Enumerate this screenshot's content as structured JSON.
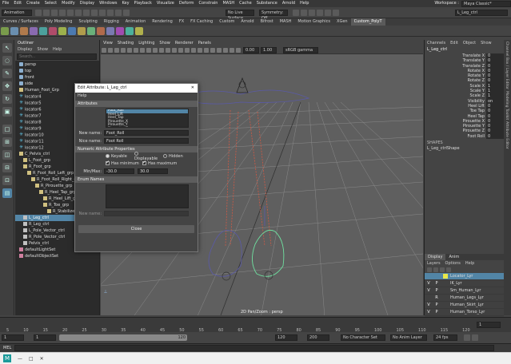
{
  "menubar": [
    "File",
    "Edit",
    "Create",
    "Select",
    "Modify",
    "Display",
    "Windows",
    "Key",
    "Playback",
    "Visualize",
    "Deform",
    "Constrain",
    "MASH",
    "Cache",
    "Substance",
    "Arnold",
    "Help"
  ],
  "workspace": {
    "label": "Workspace :",
    "value": "Maya Classic*"
  },
  "toolbar": {
    "mode": "Animation",
    "surface": "No Live Surface",
    "symmetry": "Symmetry: Off",
    "object_field": "L_Leg_ctrl"
  },
  "shelf_tabs": [
    "Curves / Surfaces",
    "Poly Modeling",
    "Sculpting",
    "Rigging",
    "Animation",
    "Rendering",
    "FX",
    "FX Caching",
    "Custom",
    "Arnold",
    "Bifrost",
    "MASH",
    "Motion Graphics",
    "XGen",
    "Custom_PolyT"
  ],
  "shelf_active": "Custom_PolyT",
  "outliner": {
    "title": "Outliner",
    "menu": [
      "Display",
      "Show",
      "Help"
    ],
    "search_placeholder": "Search...",
    "items": [
      {
        "label": "persp",
        "indent": 1,
        "kind": "cam"
      },
      {
        "label": "top",
        "indent": 1,
        "kind": "cam"
      },
      {
        "label": "front",
        "indent": 1,
        "kind": "cam"
      },
      {
        "label": "side",
        "indent": 1,
        "kind": "cam"
      },
      {
        "label": "Human_Foot_Grp",
        "indent": 1,
        "kind": "grp"
      },
      {
        "label": "locator4",
        "indent": 1,
        "kind": "loc"
      },
      {
        "label": "locator5",
        "indent": 1,
        "kind": "loc"
      },
      {
        "label": "locator6",
        "indent": 1,
        "kind": "loc"
      },
      {
        "label": "locator7",
        "indent": 1,
        "kind": "loc"
      },
      {
        "label": "locator8",
        "indent": 1,
        "kind": "loc"
      },
      {
        "label": "locator9",
        "indent": 1,
        "kind": "loc"
      },
      {
        "label": "locator10",
        "indent": 1,
        "kind": "loc"
      },
      {
        "label": "locator11",
        "indent": 1,
        "kind": "loc"
      },
      {
        "label": "locator12",
        "indent": 1,
        "kind": "loc"
      },
      {
        "label": "C_Pelvis_ctrl",
        "indent": 1,
        "kind": "grp"
      },
      {
        "label": "L_Foot_grp",
        "indent": 2,
        "kind": "grp"
      },
      {
        "label": "R_Foot_grp",
        "indent": 2,
        "kind": "grp"
      },
      {
        "label": "R_Foot_Roll_Left_grp",
        "indent": 3,
        "kind": "grp"
      },
      {
        "label": "R_Foot_Roll_Right_grp",
        "indent": 4,
        "kind": "grp"
      },
      {
        "label": "R_Pirouette_grp",
        "indent": 5,
        "kind": "grp"
      },
      {
        "label": "R_Heel_Tap_grp",
        "indent": 6,
        "kind": "grp"
      },
      {
        "label": "R_Heel_Lift_grp",
        "indent": 7,
        "kind": "grp"
      },
      {
        "label": "R_Toe_grp",
        "indent": 7,
        "kind": "grp"
      },
      {
        "label": "R_Stabilizer_ik",
        "indent": 8,
        "kind": "grp"
      },
      {
        "label": "L_Leg_ctrl",
        "indent": 2,
        "kind": "ctrl",
        "selected": true
      },
      {
        "label": "R_Leg_ctrl",
        "indent": 2,
        "kind": "ctrl"
      },
      {
        "label": "L_Pole_Vector_ctrl",
        "indent": 2,
        "kind": "ctrl"
      },
      {
        "label": "R_Pole_Vector_ctrl",
        "indent": 2,
        "kind": "ctrl"
      },
      {
        "label": "Pelvis_ctrl",
        "indent": 2,
        "kind": "ctrl"
      },
      {
        "label": "defaultLightSet",
        "indent": 1,
        "kind": "set"
      },
      {
        "label": "defaultObjectSet",
        "indent": 1,
        "kind": "set"
      }
    ]
  },
  "viewport": {
    "menu": [
      "View",
      "Shading",
      "Lighting",
      "Show",
      "Renderer",
      "Panels"
    ],
    "num1": "0.00",
    "num2": "1.00",
    "color_space": "sRGB gamma",
    "camera_label": "2D Pan/Zoom : persp"
  },
  "dialog": {
    "title": "Edit Attribute: L_Leg_ctrl",
    "menu": "Help",
    "attributes_section": "Attributes",
    "attr_list": [
      "Foot_Roll",
      "Heel_Lift",
      "Heel_Tap",
      "Pirouette_X",
      "Pirouette_Y",
      "Pirouette_Z"
    ],
    "attr_selected": "Foot_Roll",
    "new_name_label": "New name:",
    "new_name_value": "Foot_Roll",
    "nice_name_label": "Nice name:",
    "nice_name_value": "Foot Roll",
    "numeric_section": "Numeric Attribute Properties",
    "keyable": "Keyable",
    "displayable": "Displayable",
    "hidden": "Hidden",
    "has_min": "Has minimum",
    "has_max": "Has maximum",
    "minmax_label": "Min/Max:",
    "min_value": "-30.0",
    "max_value": "30.0",
    "enum_section": "Enum Names",
    "new_name_enum_label": "New name:",
    "close_label": "Close"
  },
  "channel_box": {
    "menu": [
      "Channels",
      "Edit",
      "Object",
      "Show"
    ],
    "object": "L_Leg_ctrl",
    "channels": [
      {
        "name": "Translate X",
        "value": "0"
      },
      {
        "name": "Translate Y",
        "value": "0"
      },
      {
        "name": "Translate Z",
        "value": "0"
      },
      {
        "name": "Rotate X",
        "value": "0"
      },
      {
        "name": "Rotate Y",
        "value": "0"
      },
      {
        "name": "Rotate Z",
        "value": "0"
      },
      {
        "name": "Scale X",
        "value": "1"
      },
      {
        "name": "Scale Y",
        "value": "1"
      },
      {
        "name": "Scale Z",
        "value": "1"
      },
      {
        "name": "Visibility",
        "value": "on"
      },
      {
        "name": "Heel Lift",
        "value": "0"
      },
      {
        "name": "Toe Tap",
        "value": "0"
      },
      {
        "name": "Heel Tap",
        "value": "0"
      },
      {
        "name": "Pirouette X",
        "value": "0"
      },
      {
        "name": "Pirouette Y",
        "value": "0"
      },
      {
        "name": "Pirouette Z",
        "value": "0"
      },
      {
        "name": "Foot Roll",
        "value": "0"
      }
    ],
    "shapes_header": "SHAPES",
    "shape": "L_Leg_ctrlShape"
  },
  "right_strip": [
    "Channel Box / Layer Editor",
    "Modeling Toolkit",
    "Attribute Editor"
  ],
  "layers": {
    "tabs": [
      "Display",
      "Anim"
    ],
    "menu": [
      "Layers",
      "Options",
      "Help"
    ],
    "rows": [
      {
        "v": "",
        "p": "",
        "color": "#e8e84a",
        "name": "Locator_Lyr",
        "selected": true
      },
      {
        "v": "V",
        "p": "P",
        "color": "",
        "name": "IK_Lyr"
      },
      {
        "v": "V",
        "p": "P",
        "color": "",
        "name": "Sm_Human_Lyr"
      },
      {
        "v": "",
        "p": "R",
        "color": "",
        "name": "Human_Legs_Lyr"
      },
      {
        "v": "V",
        "p": "P",
        "color": "",
        "name": "Human_Skirt_Lyr"
      },
      {
        "v": "V",
        "p": "P",
        "color": "",
        "name": "Human_Torso_Lyr"
      },
      {
        "v": "V",
        "p": "P",
        "color": "",
        "name": "Human_Head_Lyr"
      }
    ]
  },
  "timeline": {
    "ticks": [
      "5",
      "10",
      "15",
      "20",
      "25",
      "30",
      "35",
      "40",
      "45",
      "50",
      "55",
      "60",
      "65",
      "70",
      "75",
      "80",
      "85",
      "90",
      "95",
      "100",
      "105",
      "110",
      "115",
      "120"
    ],
    "current_frame": "1"
  },
  "range": {
    "start": "1",
    "start2": "1",
    "end_mark": "120",
    "end": "120",
    "end2": "200",
    "character_set": "No Character Set",
    "anim_layer": "No Anim Layer",
    "fps": "24 fps"
  },
  "cmdline": {
    "label": "MEL"
  },
  "colors": {
    "selection": "#5285a6",
    "bg": "#444444",
    "viewport": "#5f5f5f",
    "ctrl_red": "#d05a45",
    "ctrl_green": "#70e0a0"
  }
}
